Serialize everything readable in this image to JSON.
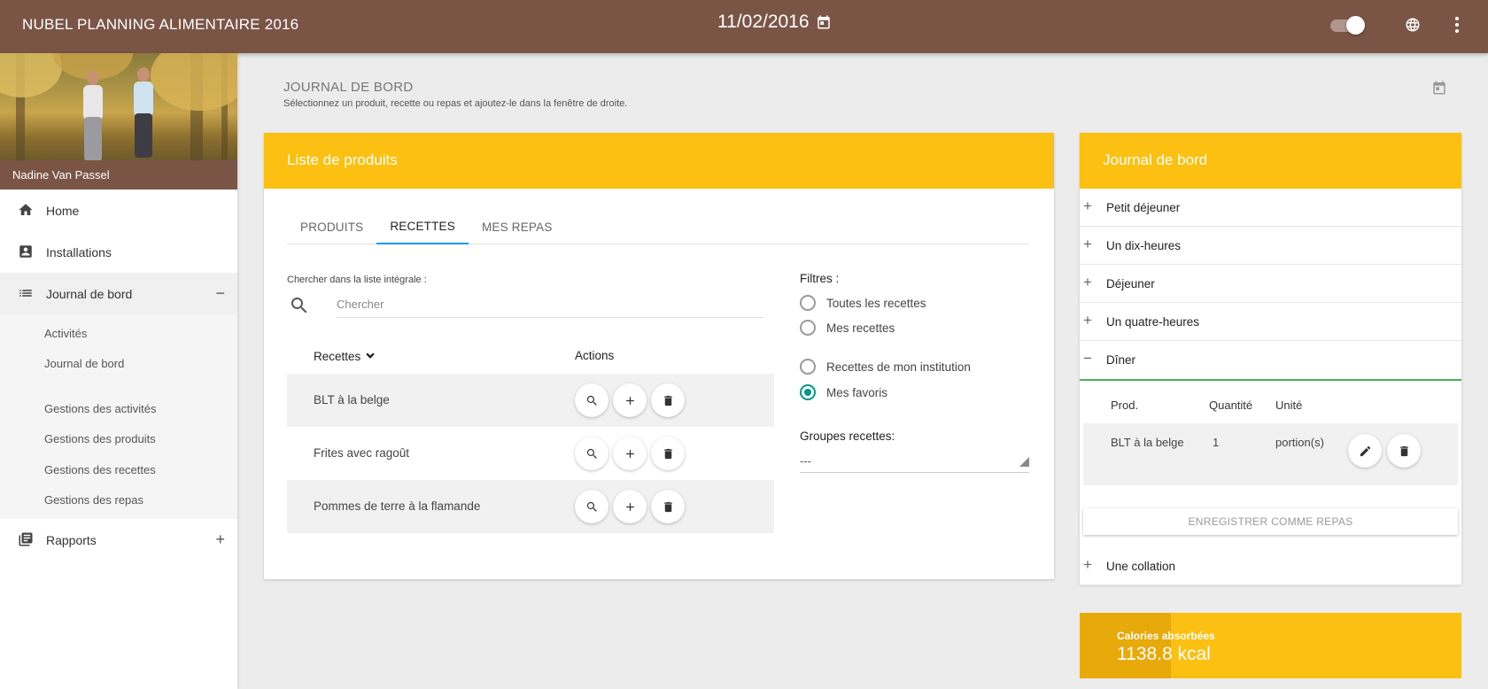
{
  "topbar": {
    "title": "NUBEL PLANNING ALIMENTAIRE 2016",
    "date": "11/02/2016",
    "icons": [
      "calendar-icon",
      "toggle-switch",
      "globe-icon",
      "more-vert-icon"
    ]
  },
  "sidebar": {
    "user_name": "Nadine Van Passel",
    "items": [
      {
        "label": "Home",
        "icon": "home-icon"
      },
      {
        "label": "Installations",
        "icon": "badge-icon"
      },
      {
        "label": "Journal de bord",
        "icon": "list-icon",
        "control": "−"
      },
      {
        "label": "Rapports",
        "icon": "library-books-icon",
        "control": "+"
      }
    ],
    "subitems": [
      "Activités",
      "Journal de bord",
      "Gestions des activités",
      "Gestions des produits",
      "Gestions des recettes",
      "Gestions des repas"
    ]
  },
  "page": {
    "heading": "JOURNAL DE BORD",
    "subtitle": "Sélectionnez un produit, recette ou repas et ajoutez-le dans la fenêtre de droite."
  },
  "products": {
    "title": "Liste de produits",
    "tabs": [
      "PRODUITS",
      "RECETTES",
      "MES REPAS"
    ],
    "active_tab": "RECETTES",
    "search_label": "Chercher dans la liste intégrale :",
    "search_placeholder": "Chercher",
    "col_recettes": "Recettes",
    "col_actions": "Actions",
    "rows": [
      "BLT à la belge",
      "Frites avec ragoût",
      "Pommes de terre à la flamande"
    ],
    "filters_title": "Filtres :",
    "filters": [
      {
        "label": "Toutes les recettes",
        "checked": false
      },
      {
        "label": "Mes recettes",
        "checked": false
      },
      {
        "label": "Recettes de mon institution",
        "checked": false
      },
      {
        "label": "Mes favoris",
        "checked": true
      }
    ],
    "groups_label": "Groupes recettes:",
    "groups_value": "---"
  },
  "journal": {
    "title": "Journal de bord",
    "meals": [
      {
        "label": "Petit déjeuner",
        "control": "+"
      },
      {
        "label": "Un dix-heures",
        "control": "+"
      },
      {
        "label": "Déjeuner",
        "control": "+"
      },
      {
        "label": "Un quatre-heures",
        "control": "+"
      },
      {
        "label": "Dîner",
        "control": "−"
      },
      {
        "label": "Une collation",
        "control": "+"
      }
    ],
    "diner_headers": [
      "Prod.",
      "Quantité",
      "Unité"
    ],
    "diner_row": {
      "product": "BLT à la belge",
      "quantity": "1",
      "unit": "portion(s)"
    },
    "save_meal_label": "ENREGISTRER COMME REPAS"
  },
  "calories": {
    "label": "Calories absorbées",
    "value": "1138.8 kcal",
    "progress_fraction": 0.24
  },
  "colors": {
    "topbar": "#7a5546",
    "accent": "#fbc011",
    "radio_checked": "#009688",
    "tab_indicator": "#2196f3",
    "open_meal_border": "#4caf50"
  }
}
